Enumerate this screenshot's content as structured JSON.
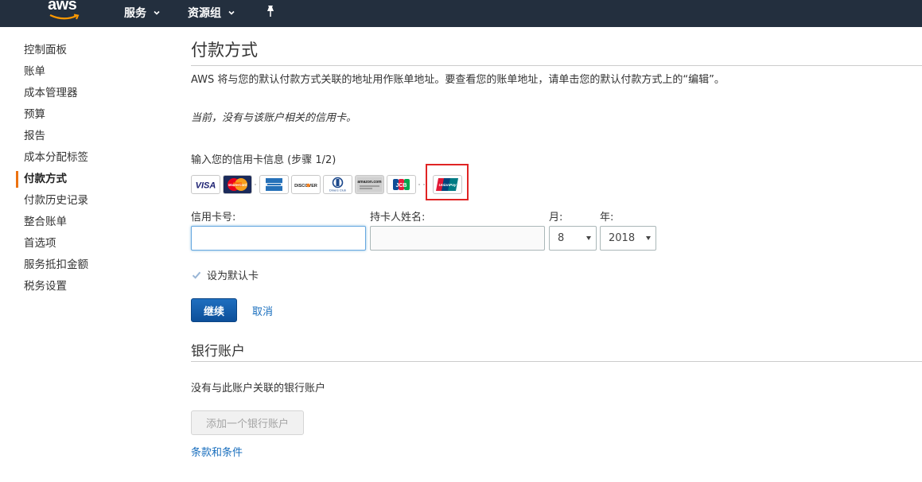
{
  "nav": {
    "logo_text": "aws",
    "services_label": "服务",
    "resource_groups_label": "资源组",
    "pin_icon": "pin-icon"
  },
  "sidebar": {
    "items": [
      {
        "label": "控制面板"
      },
      {
        "label": "账单"
      },
      {
        "label": "成本管理器"
      },
      {
        "label": "预算"
      },
      {
        "label": "报告"
      },
      {
        "label": "成本分配标签"
      },
      {
        "label": "付款方式",
        "active": true
      },
      {
        "label": "付款历史记录"
      },
      {
        "label": "整合账单"
      },
      {
        "label": "首选项"
      },
      {
        "label": "服务抵扣金额"
      },
      {
        "label": "税务设置"
      }
    ]
  },
  "main": {
    "title": "付款方式",
    "intro": "AWS 将与您的默认付款方式关联的地址用作账单地址。要查看您的账单地址，请单击您的默认付款方式上的“编辑”。",
    "current_note": "当前，没有与该账户相关的信用卡。",
    "step_label": "输入您的信用卡信息 (步骤 1/2)",
    "cards": [
      {
        "name": "VISA"
      },
      {
        "name": "MasterCard"
      },
      {
        "name": "American Express"
      },
      {
        "name": "DISCOVER"
      },
      {
        "name": "Diners Club"
      },
      {
        "name": "amazon.com"
      },
      {
        "name": "JCB"
      },
      {
        "name": "UnionPay"
      }
    ],
    "card_icon_labels": {
      "visa": "VISA",
      "mastercard": "MasterCard",
      "discover": "DISCOVER",
      "diners": "Diners Club",
      "amazon": "amazon.com",
      "jcb": "JCB",
      "unionpay": "UnionPay"
    },
    "form": {
      "card_number_label": "信用卡号:",
      "card_number_value": "",
      "holder_name_label": "持卡人姓名:",
      "holder_name_value": "",
      "month_label": "月:",
      "month_value": "8",
      "year_label": "年:",
      "year_value": "2018",
      "default_checkbox_label": "设为默认卡",
      "default_checked": true,
      "continue_label": "继续",
      "cancel_label": "取消"
    },
    "bank": {
      "title": "银行账户",
      "note": "没有与此账户关联的银行账户",
      "add_button": "添加一个银行账户",
      "terms_link": "条款和条件"
    }
  },
  "colors": {
    "nav_bg": "#232f3e",
    "accent_orange": "#ec7211",
    "primary_blue": "#1a6fbe",
    "highlight_red": "#e02424"
  }
}
